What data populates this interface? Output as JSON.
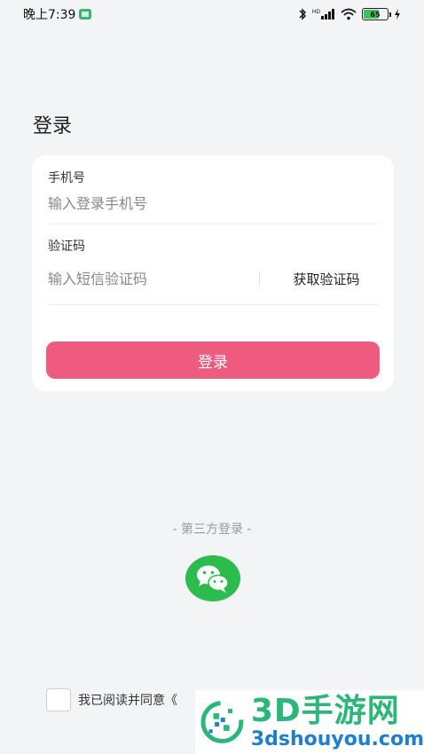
{
  "status_bar": {
    "time": "晚上7:39",
    "network": "HD",
    "battery": "65"
  },
  "title": "登录",
  "form": {
    "phone_label": "手机号",
    "phone_placeholder": "输入登录手机号",
    "code_label": "验证码",
    "code_placeholder": "输入短信验证码",
    "get_code_label": "获取验证码",
    "login_label": "登录"
  },
  "third_party": {
    "label": "- 第三方登录 -"
  },
  "agreement": {
    "text": "我已阅读并同意《"
  },
  "watermark": {
    "title": "3D手游网",
    "url": "3dshouyou.com"
  },
  "colors": {
    "accent": "#ef5a7f",
    "wechat": "#2cbb4d",
    "background": "#f3f4f6"
  }
}
